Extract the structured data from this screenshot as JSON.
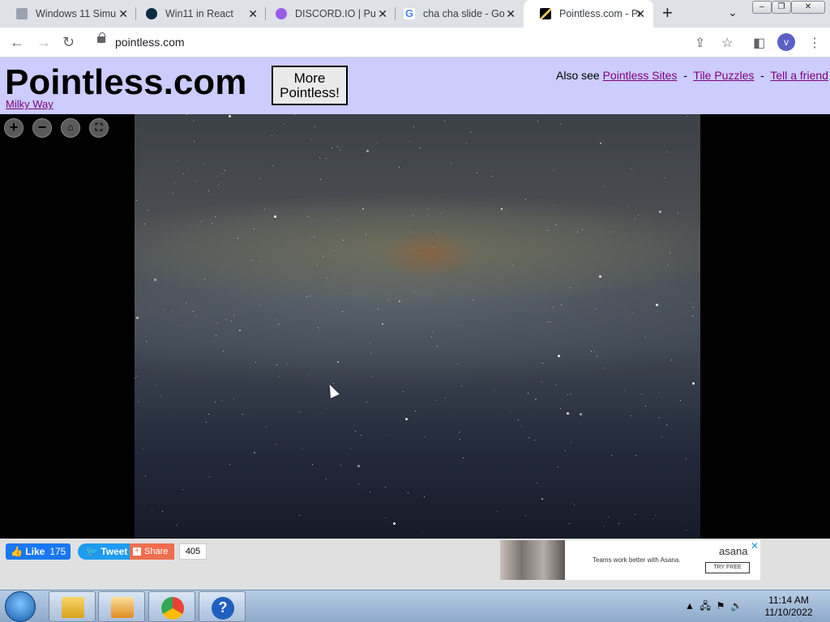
{
  "browser": {
    "tabs": [
      {
        "title": "Windows 11 Simu",
        "icon": "page-icon"
      },
      {
        "title": "Win11 in React",
        "icon": "react-icon"
      },
      {
        "title": "DISCORD.IO | Pub",
        "icon": "discord-icon"
      },
      {
        "title": "cha cha slide - Go",
        "icon": "google-icon"
      },
      {
        "title": "Pointless.com - Po",
        "icon": "pencil-icon"
      }
    ],
    "url": "pointless.com",
    "profile_initial": "v"
  },
  "site": {
    "title": "Pointless.com",
    "subtitle_link": "Milky Way",
    "more_button": "More Pointless!",
    "also_see": "Also see",
    "links": [
      "Pointless Sites",
      "Tile Puzzles",
      "Tell a friend"
    ],
    "separator": "-"
  },
  "viewer": {
    "zoom_controls": [
      "zoom-in",
      "zoom-out",
      "home",
      "full-screen"
    ]
  },
  "social": {
    "like_label": "Like",
    "like_count": "175",
    "tweet_label": "Tweet",
    "share_label": "Share",
    "share_count": "405"
  },
  "ad": {
    "brand": "asana",
    "text": "Teams work better with Asana.",
    "cta": "TRY FREE"
  },
  "taskbar": {
    "time": "11:14 AM",
    "date": "11/10/2022"
  },
  "colors": {
    "header_bg": "#ccccff",
    "link": "#800080",
    "facebook": "#1877f2",
    "twitter": "#1d9bf0"
  }
}
